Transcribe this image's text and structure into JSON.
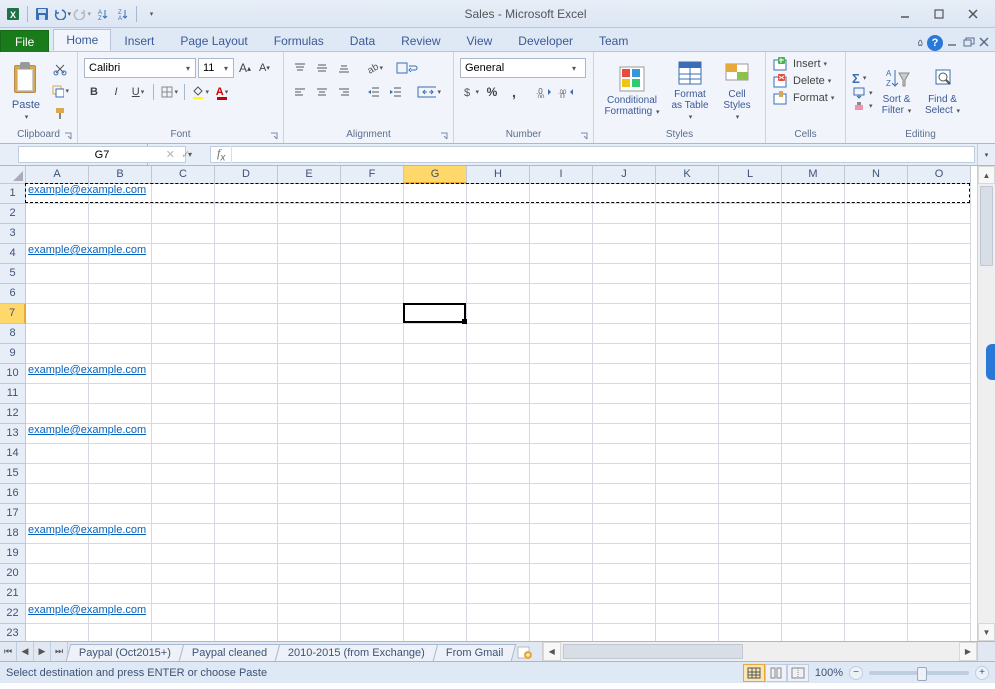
{
  "titlebar": {
    "title": "Sales  -  Microsoft Excel"
  },
  "tabs": {
    "file": "File",
    "items": [
      "Home",
      "Insert",
      "Page Layout",
      "Formulas",
      "Data",
      "Review",
      "View",
      "Developer",
      "Team"
    ],
    "active": 0
  },
  "ribbon": {
    "clipboard": {
      "paste": "Paste",
      "label": "Clipboard"
    },
    "font": {
      "name": "Calibri",
      "size": "11",
      "label": "Font"
    },
    "alignment": {
      "label": "Alignment"
    },
    "number": {
      "format": "General",
      "label": "Number"
    },
    "styles": {
      "cond": "Conditional Formatting",
      "table": "Format as Table",
      "cell": "Cell Styles",
      "label": "Styles"
    },
    "cells": {
      "insert": "Insert",
      "delete": "Delete",
      "format": "Format",
      "label": "Cells"
    },
    "editing": {
      "sort": "Sort & Filter",
      "find": "Find & Select",
      "label": "Editing"
    }
  },
  "formula": {
    "namebox": "G7",
    "value": ""
  },
  "grid": {
    "columns": [
      "A",
      "B",
      "C",
      "D",
      "E",
      "F",
      "G",
      "H",
      "I",
      "J",
      "K",
      "L",
      "M",
      "N",
      "O"
    ],
    "activeCol": 6,
    "rows": 23,
    "activeRow": 7,
    "activeCell": "G7",
    "copiedRange": "A1:O1",
    "links": [
      {
        "row": 1,
        "text": "example@example.com"
      },
      {
        "row": 4,
        "text": "example@example.com"
      },
      {
        "row": 10,
        "text": "example@example.com"
      },
      {
        "row": 13,
        "text": "example@example.com"
      },
      {
        "row": 18,
        "text": "example@example.com"
      },
      {
        "row": 22,
        "text": "example@example.com"
      }
    ]
  },
  "sheets": {
    "tabs": [
      "Paypal (Oct2015+)",
      "Paypal cleaned",
      "2010-2015 (from Exchange)",
      "From Gmail"
    ],
    "active": -1
  },
  "status": {
    "message": "Select destination and press ENTER or choose Paste",
    "zoom": "100%"
  }
}
